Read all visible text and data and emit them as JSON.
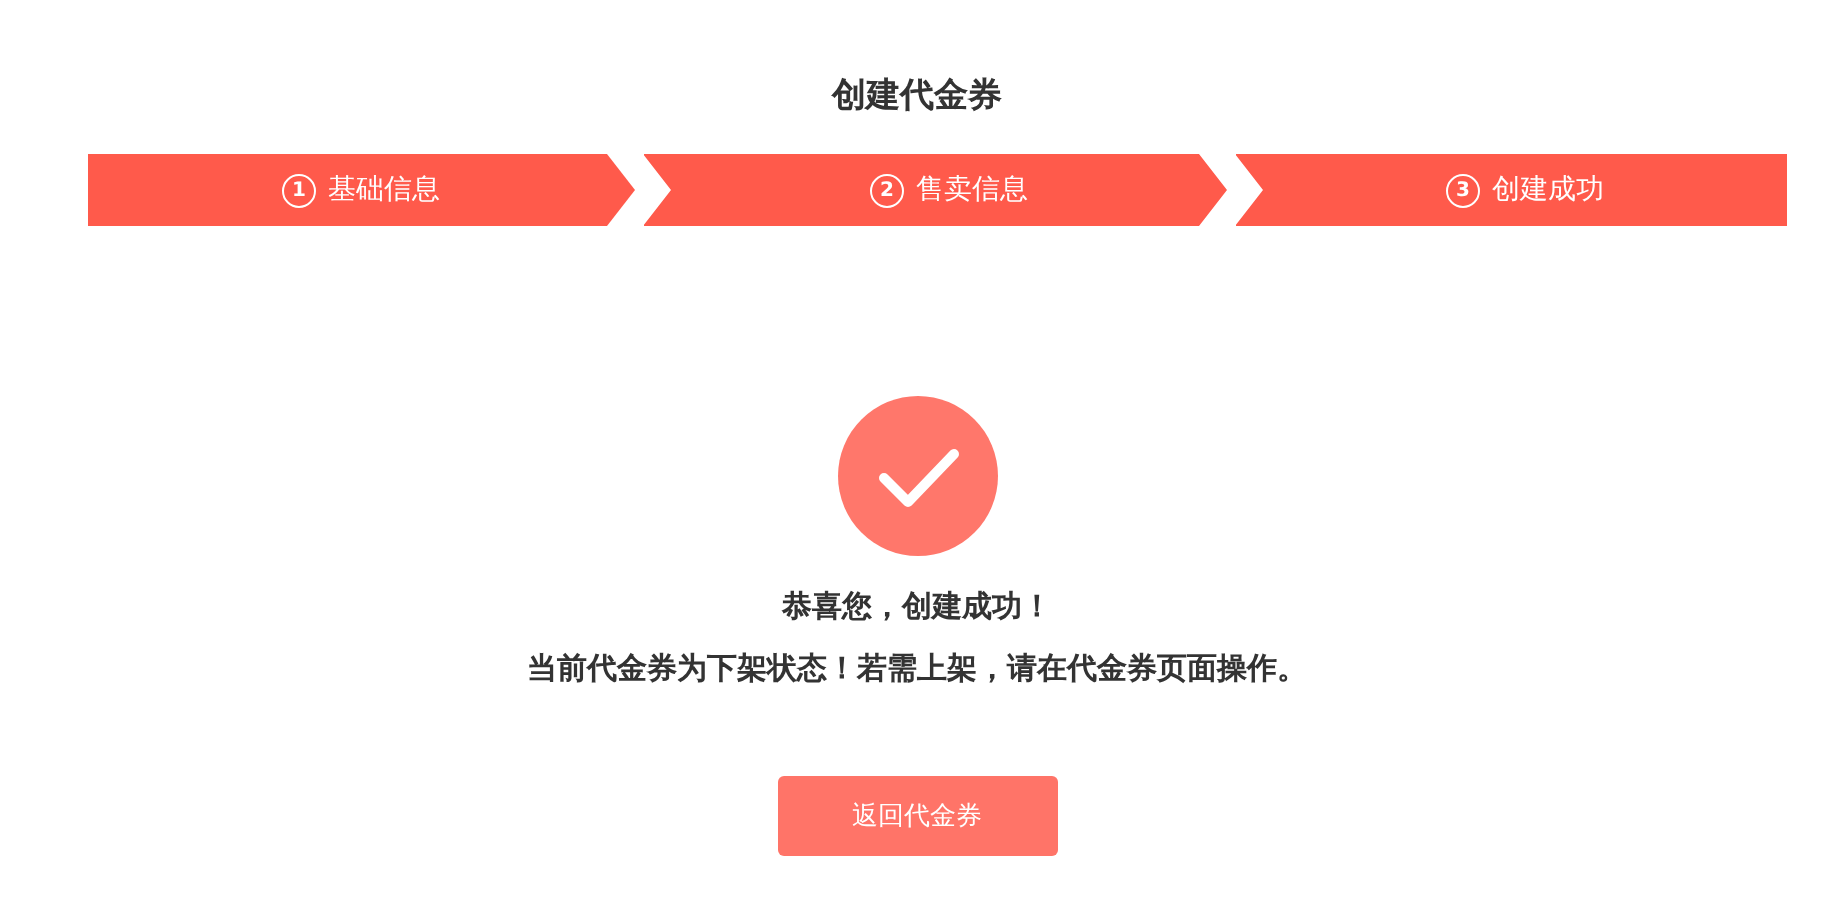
{
  "title": "创建代金券",
  "steps": [
    {
      "number": "1",
      "label": "基础信息"
    },
    {
      "number": "2",
      "label": "售卖信息"
    },
    {
      "number": "3",
      "label": "创建成功"
    }
  ],
  "result": {
    "headline": "恭喜您，创建成功！",
    "message": "当前代金券为下架状态！若需上架，请在代金券页面操作。"
  },
  "button": "返回代金券"
}
